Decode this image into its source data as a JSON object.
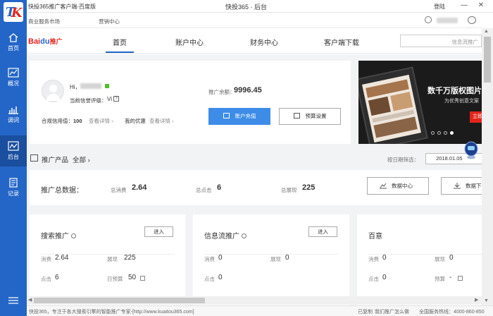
{
  "window": {
    "title": "快投365推广客户端-百度版",
    "app_title": "快投365 · 后台",
    "login_label": "登陆",
    "min_glyph": "—",
    "close_glyph": "✕"
  },
  "sidebar": {
    "items": [
      {
        "label": "首页",
        "icon": "home-icon"
      },
      {
        "label": "概况",
        "icon": "overview-chart-icon"
      },
      {
        "label": "调词",
        "icon": "bar-chart-icon"
      },
      {
        "label": "后台",
        "icon": "line-chart-icon"
      },
      {
        "label": "记录",
        "icon": "record-icon"
      }
    ],
    "active": "后台"
  },
  "subbar": {
    "links": [
      "商业服务市场",
      "营销中心"
    ]
  },
  "nav": {
    "logo": {
      "part1": "Bai",
      "part2": "du",
      "part3": "推广"
    },
    "tabs": [
      "首页",
      "账户中心",
      "财务中心",
      "客户端下载"
    ],
    "active_tab": "首页",
    "search_placeholder": "信息流推广"
  },
  "account": {
    "greeting": "Hi，",
    "credit_level_label": "当前信誉评级：",
    "credit_level_value": "Vi",
    "credit_help": "?",
    "credit_score_label": "合规信用值：",
    "credit_score_value": "100",
    "detail_link": "查看详情 ›",
    "coupon_label": "我的优惠",
    "coupon_detail_link": "查看详情 ›",
    "balance_label": "推广余额：",
    "balance_value": "9996.45",
    "recharge_button": "账户充值",
    "warning_button": "预算设置"
  },
  "banner": {
    "headline": "数千万版权图片",
    "subline": "为优秀创意文案",
    "button": "立即",
    "slides": 4,
    "active_slide": 4
  },
  "products": {
    "section_title": "推广产品",
    "all_label": "全部 ›",
    "date_label": "按日期筛选：",
    "date_value": "2018.01.05"
  },
  "summary": {
    "title": "推广总数据：",
    "metrics": [
      {
        "label": "总消费",
        "value": "2.64"
      },
      {
        "label": "总点击",
        "value": "6"
      },
      {
        "label": "总展现",
        "value": "225"
      }
    ],
    "buttons": [
      {
        "label": "数据中心",
        "icon": "chart-icon"
      },
      {
        "label": "数据下",
        "icon": "download-icon"
      }
    ]
  },
  "product_cards": [
    {
      "title": "搜索推广",
      "enter": "进入",
      "rows": [
        [
          {
            "label": "消费",
            "value": "2.64"
          },
          {
            "label": "展现",
            "value": "225"
          }
        ],
        [
          {
            "label": "点击",
            "value": "6"
          },
          {
            "label": "日预算",
            "value": "50"
          }
        ]
      ]
    },
    {
      "title": "信息流推广",
      "enter": "进入",
      "rows": [
        [
          {
            "label": "消费",
            "value": "0"
          },
          {
            "label": "展现",
            "value": "0"
          }
        ],
        [
          {
            "label": "点击",
            "value": "0"
          },
          {
            "label": "",
            "value": ""
          }
        ]
      ]
    },
    {
      "title": "百意",
      "enter": "",
      "rows": [
        [
          {
            "label": "消费",
            "value": "0"
          },
          {
            "label": "展现",
            "value": "0"
          }
        ],
        [
          {
            "label": "点击",
            "value": "0"
          },
          {
            "label": "预算",
            "value": "-"
          }
        ]
      ]
    }
  ],
  "statusbar": {
    "left": "快投365，专注于各大搜索引擎的智能推广专家-[http://www.kuaitou365.com]",
    "copy": "已复制",
    "help": "我们推广怎么做",
    "hotline": "全国服务热线：4000-860-850"
  },
  "colors": {
    "brand_blue": "#2466c7",
    "recharge_blue": "#3d8de8",
    "baidu_red": "#e1251b"
  }
}
